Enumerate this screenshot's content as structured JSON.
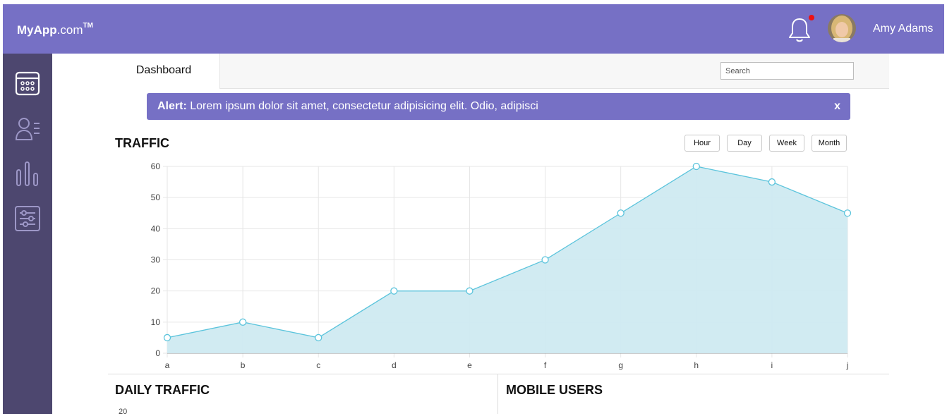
{
  "header": {
    "logo_bold": "MyApp",
    "logo_light": ".com",
    "logo_tm": "TM",
    "user_name": "Amy Adams",
    "bell_icon": "bell-icon",
    "notification_dot_color": "#e11111"
  },
  "sidebar": {
    "items": [
      {
        "icon": "calendar-icon",
        "active": true
      },
      {
        "icon": "user-list-icon",
        "active": false
      },
      {
        "icon": "bar-chart-icon",
        "active": false
      },
      {
        "icon": "sliders-icon",
        "active": false
      }
    ]
  },
  "tabs": {
    "active_label": "Dashboard",
    "search_placeholder": "Search"
  },
  "alert": {
    "label": "Alert:",
    "message": " Lorem ipsum dolor sit amet, consectetur adipisicing elit. Odio, adipisci",
    "close_label": "x"
  },
  "traffic": {
    "title": "TRAFFIC",
    "ranges": [
      "Hour",
      "Day",
      "Week",
      "Month"
    ]
  },
  "daily_traffic": {
    "title": "DAILY TRAFFIC",
    "first_tick": "20"
  },
  "mobile_users": {
    "title": "MOBILE USERS"
  },
  "colors": {
    "accent": "#7670c5",
    "sidebar": "#4d476f",
    "chart_line": "#5bc4dc",
    "chart_fill": "#cfeaf1"
  },
  "chart_data": {
    "type": "area",
    "x": [
      "a",
      "b",
      "c",
      "d",
      "e",
      "f",
      "g",
      "h",
      "i",
      "j"
    ],
    "series": [
      {
        "values": [
          5,
          10,
          5,
          20,
          20,
          30,
          45,
          60,
          55,
          45
        ]
      }
    ],
    "ylim": [
      0,
      60
    ],
    "yticks": [
      0,
      10,
      20,
      30,
      40,
      50,
      60
    ],
    "grid": true
  }
}
